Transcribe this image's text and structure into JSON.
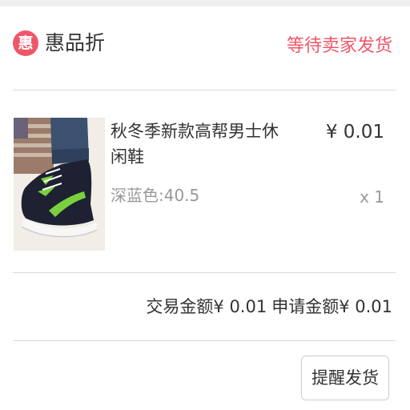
{
  "store": {
    "logo_char": "惠",
    "name": "惠品折",
    "status": "等待卖家发货"
  },
  "product": {
    "title": "秋冬季新款高帮男士休闲鞋",
    "variant": "深蓝色:40.5",
    "price": "¥ 0.01",
    "quantity": "x 1",
    "image_icon": "sneaker-photo"
  },
  "totals": {
    "trade_label": "交易金额",
    "trade_amount": "¥ 0.01",
    "apply_label": "申请金额",
    "apply_amount": "¥ 0.01"
  },
  "actions": {
    "remind_ship_label": "提醒发货"
  },
  "colors": {
    "accent": "#f0566a",
    "text": "#333333",
    "muted": "#999999",
    "divider": "#d9d9d9"
  }
}
